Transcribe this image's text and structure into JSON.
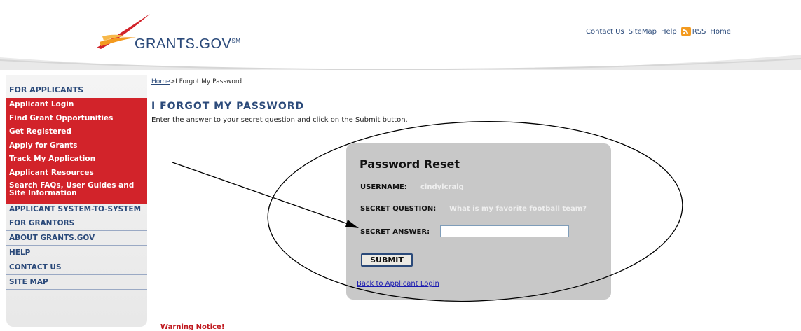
{
  "header": {
    "logo_text": "GRANTS.GOV",
    "logo_mark": "SM",
    "links": {
      "contact": "Contact Us",
      "sitemap": "SiteMap",
      "help": "Help",
      "rss": "RSS",
      "home": "Home"
    },
    "rss_icon": "rss-icon"
  },
  "sidebar": {
    "heading": "FOR APPLICANTS",
    "red_items": [
      "Applicant Login",
      "Find Grant Opportunities",
      "Get Registered",
      "Apply for Grants",
      "Track My Application",
      "Applicant Resources",
      "Search FAQs, User Guides and Site Information"
    ],
    "nav_items": [
      "APPLICANT SYSTEM-TO-SYSTEM",
      "FOR GRANTORS",
      "ABOUT GRANTS.GOV",
      "HELP",
      "CONTACT US",
      "SITE MAP"
    ]
  },
  "breadcrumb": {
    "home": "Home",
    "separator": ">",
    "current": "I Forgot My Password"
  },
  "page": {
    "title": "I FORGOT MY PASSWORD",
    "instructions": "Enter the answer to your secret question and click on the Submit button."
  },
  "form": {
    "title": "Password Reset",
    "username_label": "USERNAME:",
    "username_value": "cindylcraig",
    "question_label": "SECRET QUESTION:",
    "question_value": "What is my favorite football team?",
    "answer_label": "SECRET ANSWER:",
    "answer_value": "",
    "submit_label": "SUBMIT",
    "back_link": "Back to Applicant Login"
  },
  "warning": "Warning Notice!",
  "colors": {
    "brand_blue": "#2b4a7a",
    "brand_red": "#d2232a",
    "panel_gray": "#c8c8c8"
  }
}
